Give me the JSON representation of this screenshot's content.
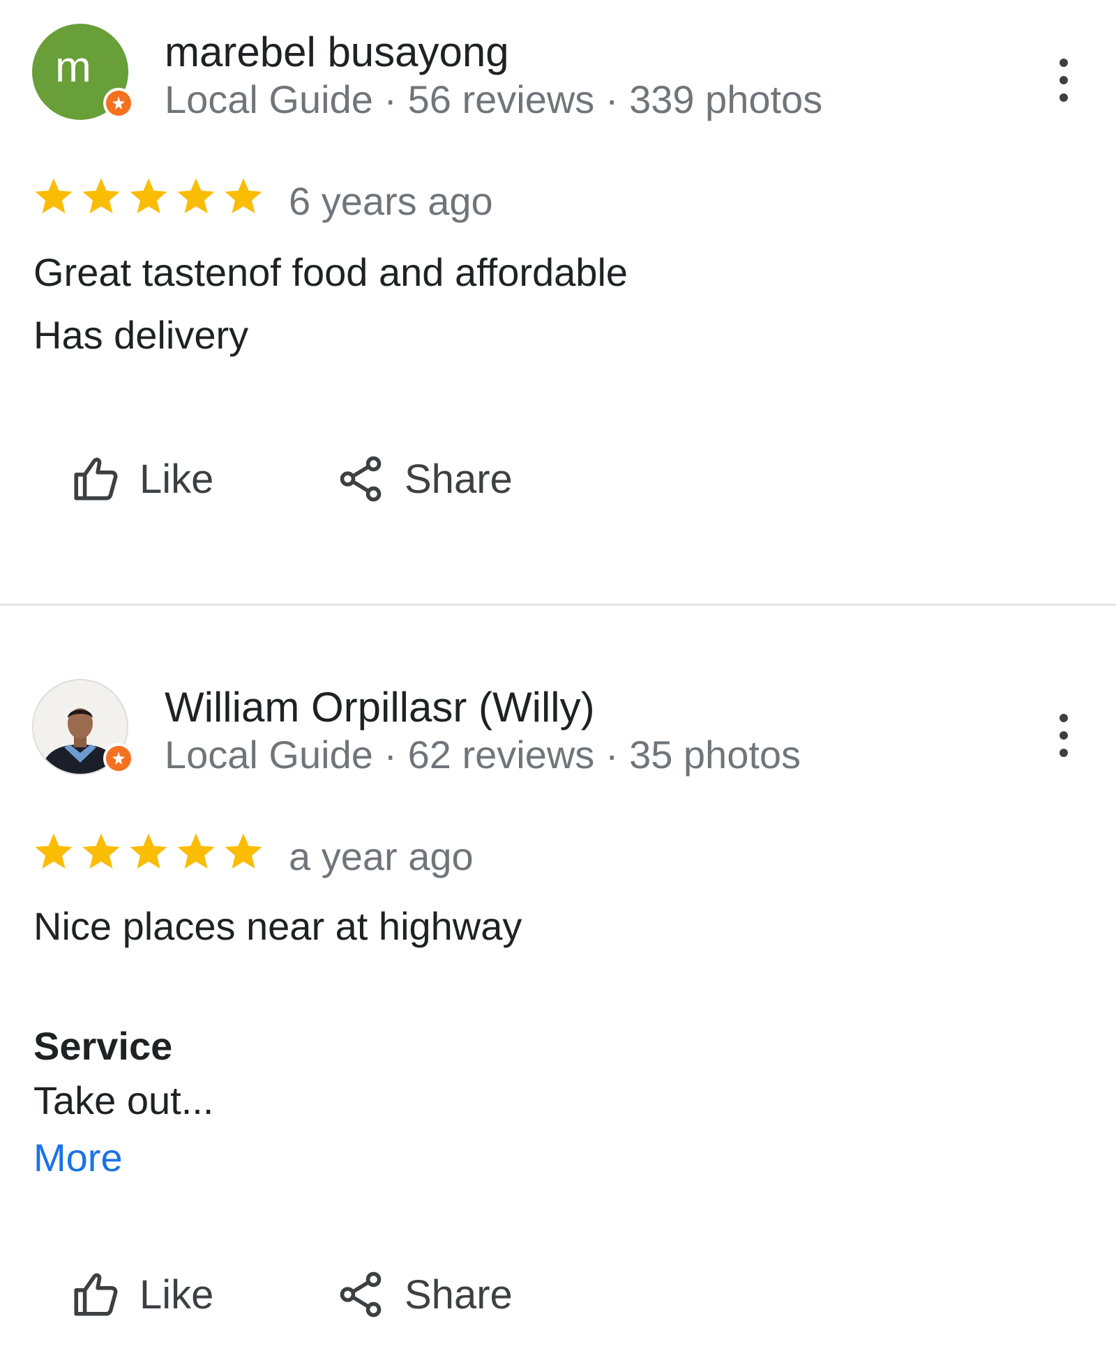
{
  "reviews": [
    {
      "author": "marebel busayong",
      "avatar_letter": "m",
      "meta": "Local Guide · 56 reviews · 339 photos",
      "rating": 5,
      "time": "6 years ago",
      "text_lines": [
        "Great tastenof food and affordable",
        "Has delivery"
      ],
      "actions": {
        "like": "Like",
        "share": "Share"
      }
    },
    {
      "author": "William Orpillasr (Willy)",
      "meta": "Local Guide · 62 reviews · 35 photos",
      "rating": 5,
      "time": "a year ago",
      "text_lines": [
        "Nice places near at highway"
      ],
      "section_title": "Service",
      "section_text": "Take out...",
      "more_link": "More",
      "actions": {
        "like": "Like",
        "share": "Share"
      }
    }
  ],
  "icons": [
    "more-vert-icon",
    "star-icon",
    "thumb-up-icon",
    "share-icon",
    "local-guide-badge-icon"
  ],
  "colors": {
    "star": "#fbbc04",
    "link": "#1a73e8",
    "secondary_text": "#70757a",
    "guide_badge": "#f4711f",
    "avatar_bg": "#689f38"
  }
}
